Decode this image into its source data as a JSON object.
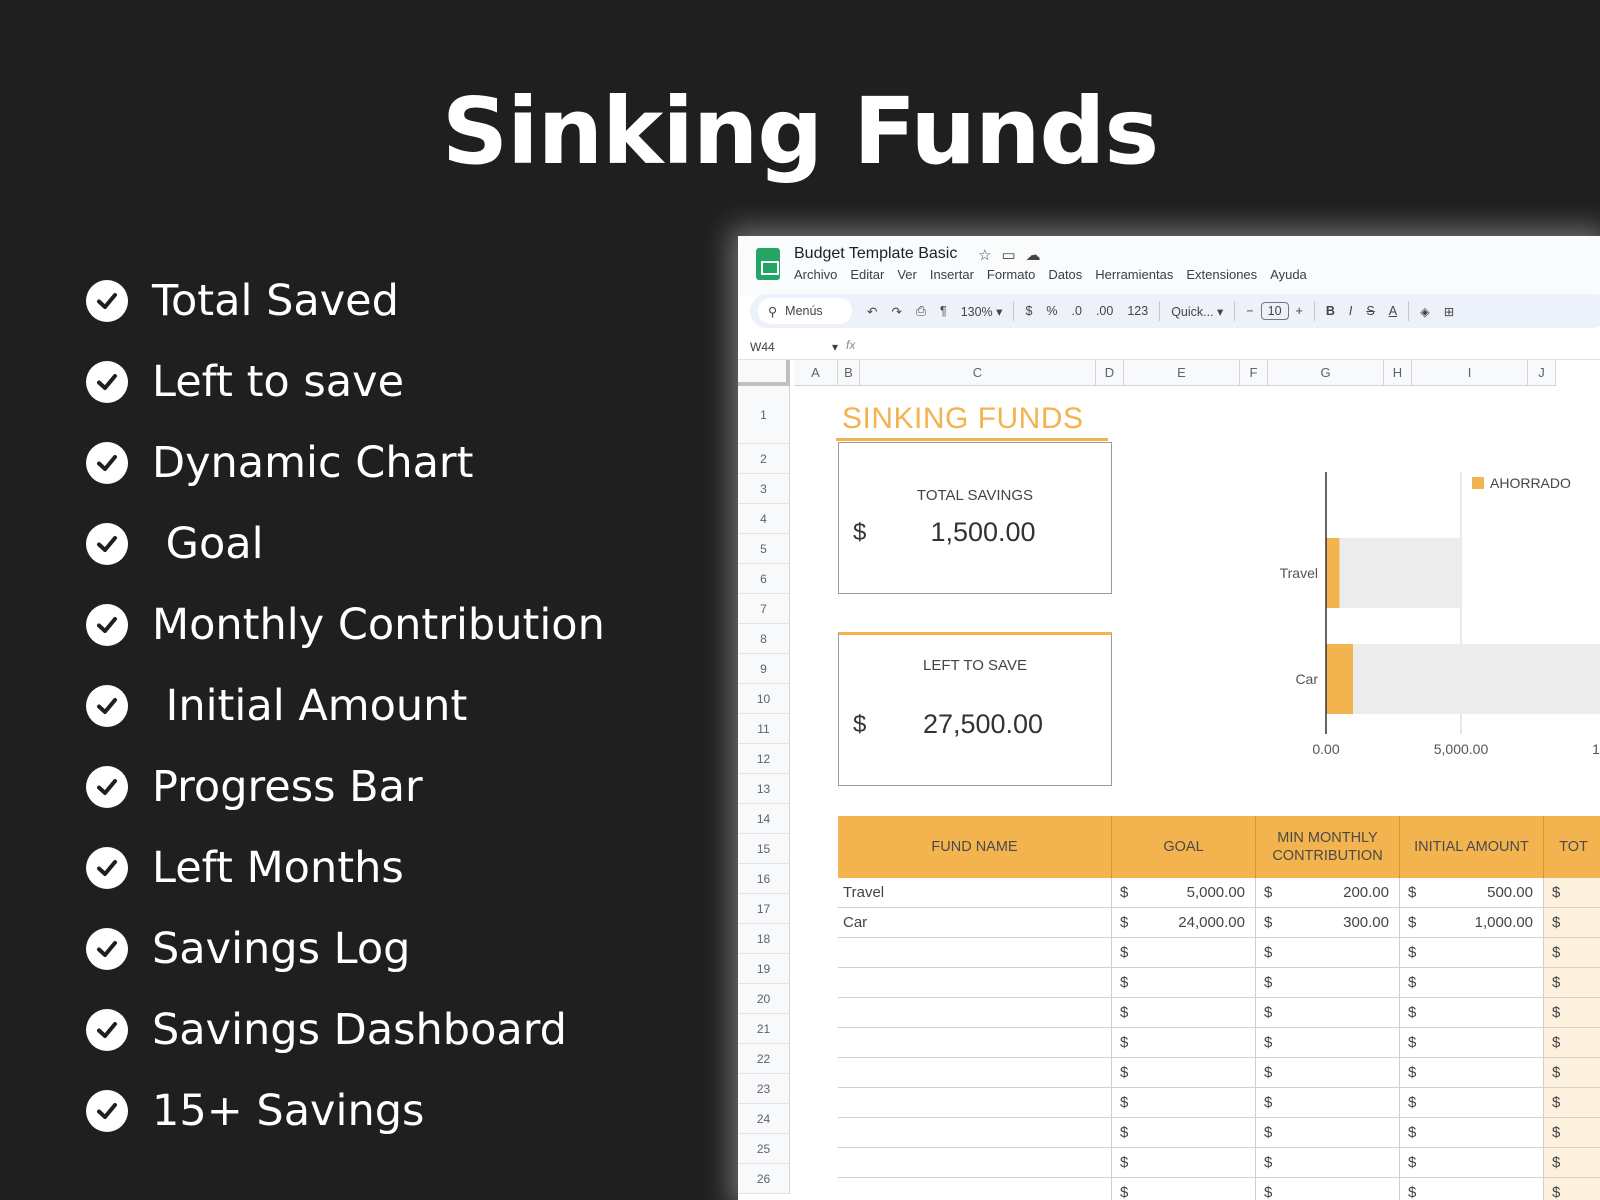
{
  "hero_title": "Sinking Funds",
  "features": [
    "Total Saved",
    "Left to save",
    "Dynamic Chart",
    " Goal",
    "Monthly Contribution",
    " Initial Amount",
    "Progress Bar",
    "Left Months",
    "Savings Log",
    "Savings Dashboard",
    "15+ Savings"
  ],
  "sheet": {
    "doc_title": "Budget Template Basic",
    "menu": [
      "Archivo",
      "Editar",
      "Ver",
      "Insertar",
      "Formato",
      "Datos",
      "Herramientas",
      "Extensiones",
      "Ayuda"
    ],
    "toolbar": {
      "search": "Menús",
      "zoom": "130%",
      "currency": "$",
      "percent": "%",
      "dec_less": ".0",
      "dec_more": ".00",
      "number": "123",
      "font": "Quick...",
      "font_size": "10",
      "bold": "B",
      "italic": "I"
    },
    "name_box": "W44",
    "fx": "fx",
    "columns": [
      "A",
      "B",
      "C",
      "D",
      "E",
      "F",
      "G",
      "H",
      "I",
      "J"
    ],
    "rows": [
      "1",
      "2",
      "3",
      "4",
      "5",
      "6",
      "7",
      "8",
      "9",
      "10",
      "11",
      "12",
      "13",
      "14",
      "15",
      "16",
      "17",
      "18",
      "19",
      "20",
      "21",
      "22",
      "23",
      "24",
      "25",
      "26"
    ],
    "sf_title": "SINKING FUNDS",
    "total_savings": {
      "label": "TOTAL SAVINGS",
      "currency": "$",
      "value": "1,500.00"
    },
    "left_to_save": {
      "label": "LEFT TO SAVE",
      "currency": "$",
      "value": "27,500.00"
    },
    "table_headers": [
      "FUND NAME",
      "GOAL",
      "MIN MONTHLY CONTRIBUTION",
      "INITIAL AMOUNT",
      "TOT"
    ],
    "table_rows": [
      {
        "fund": "Travel",
        "goal": "5,000.00",
        "min": "200.00",
        "initial": "500.00"
      },
      {
        "fund": "Car",
        "goal": "24,000.00",
        "min": "300.00",
        "initial": "1,000.00"
      }
    ],
    "dollar": "$"
  },
  "chart_data": {
    "type": "bar",
    "orientation": "horizontal",
    "stacked": true,
    "categories": [
      "Travel",
      "Car"
    ],
    "series": [
      {
        "name": "AHORRADO",
        "values": [
          500,
          1000
        ],
        "color": "#f3b34f"
      },
      {
        "values": [
          4500,
          23000
        ],
        "color": "#ececec"
      }
    ],
    "x_ticks": [
      "0.00",
      "5,000.00",
      "1"
    ],
    "xlim": [
      0,
      10000
    ],
    "legend": "top-right",
    "grid": true
  }
}
